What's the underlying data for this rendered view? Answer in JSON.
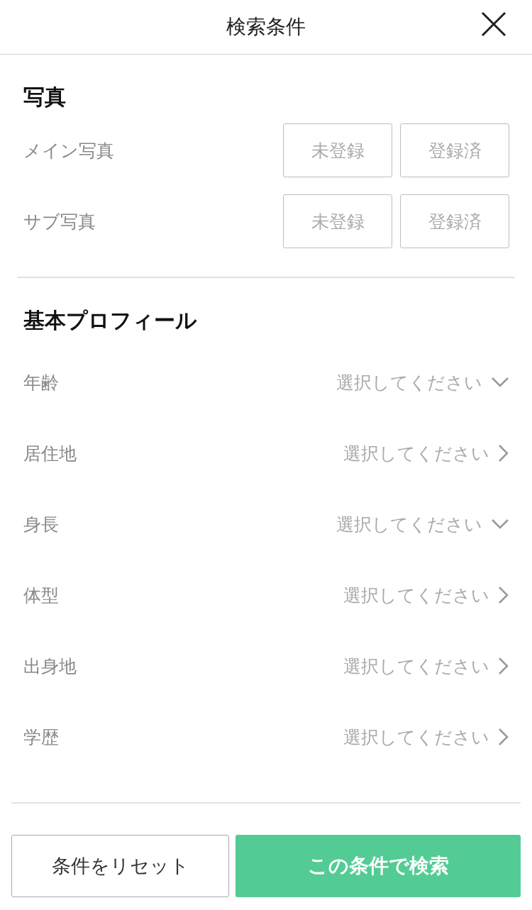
{
  "header": {
    "title": "検索条件"
  },
  "photo_section": {
    "title": "写真",
    "rows": [
      {
        "label": "メイン写真",
        "options": [
          {
            "label": "未登録",
            "selected": false
          },
          {
            "label": "登録済",
            "selected": false
          }
        ]
      },
      {
        "label": "サブ写真",
        "options": [
          {
            "label": "未登録",
            "selected": false
          },
          {
            "label": "登録済",
            "selected": false
          }
        ]
      }
    ]
  },
  "profile_section": {
    "title": "基本プロフィール",
    "rows": [
      {
        "label": "年齢",
        "value": "選択してください",
        "kind": "dropdown"
      },
      {
        "label": "居住地",
        "value": "選択してください",
        "kind": "link"
      },
      {
        "label": "身長",
        "value": "選択してください",
        "kind": "dropdown"
      },
      {
        "label": "体型",
        "value": "選択してください",
        "kind": "link"
      },
      {
        "label": "出身地",
        "value": "選択してください",
        "kind": "link"
      },
      {
        "label": "学歴",
        "value": "選択してください",
        "kind": "link"
      }
    ]
  },
  "footer": {
    "reset_button": "条件をリセット",
    "search_button": "この条件で検索"
  }
}
